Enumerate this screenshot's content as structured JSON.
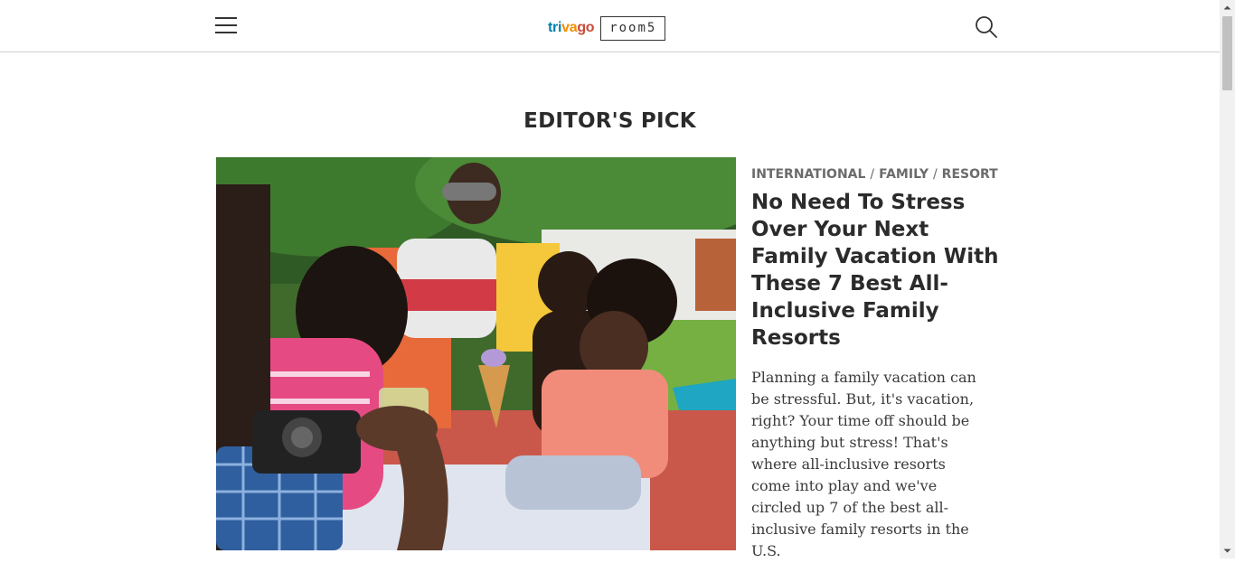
{
  "header": {
    "logo_primary": "trivago",
    "logo_secondary": "room5",
    "menu_icon": "hamburger-menu-icon",
    "search_icon": "search-icon"
  },
  "section": {
    "title": "EDITOR'S PICK"
  },
  "featured": {
    "tags": [
      "INTERNATIONAL",
      "FAMILY",
      "RESORT"
    ],
    "tag_separator": "/",
    "headline": "No Need To Stress Over Your Next Family Vacation With These 7 Best All-Inclusive Family Resorts",
    "excerpt": "Planning a family vacation can be stressful. But, it's vacation, right? Your time off should be anything but stress! That's where all-inclusive resorts come into play and we've circled up 7 of the best all-inclusive family resorts in the U.S.",
    "image": "family-picnic-photo"
  },
  "colors": {
    "text_dark": "#2b2b2b",
    "tag_gray": "#6b6b6b",
    "trivago_blue": "#007faf",
    "trivago_orange": "#f48f00",
    "trivago_red": "#c94a38"
  }
}
